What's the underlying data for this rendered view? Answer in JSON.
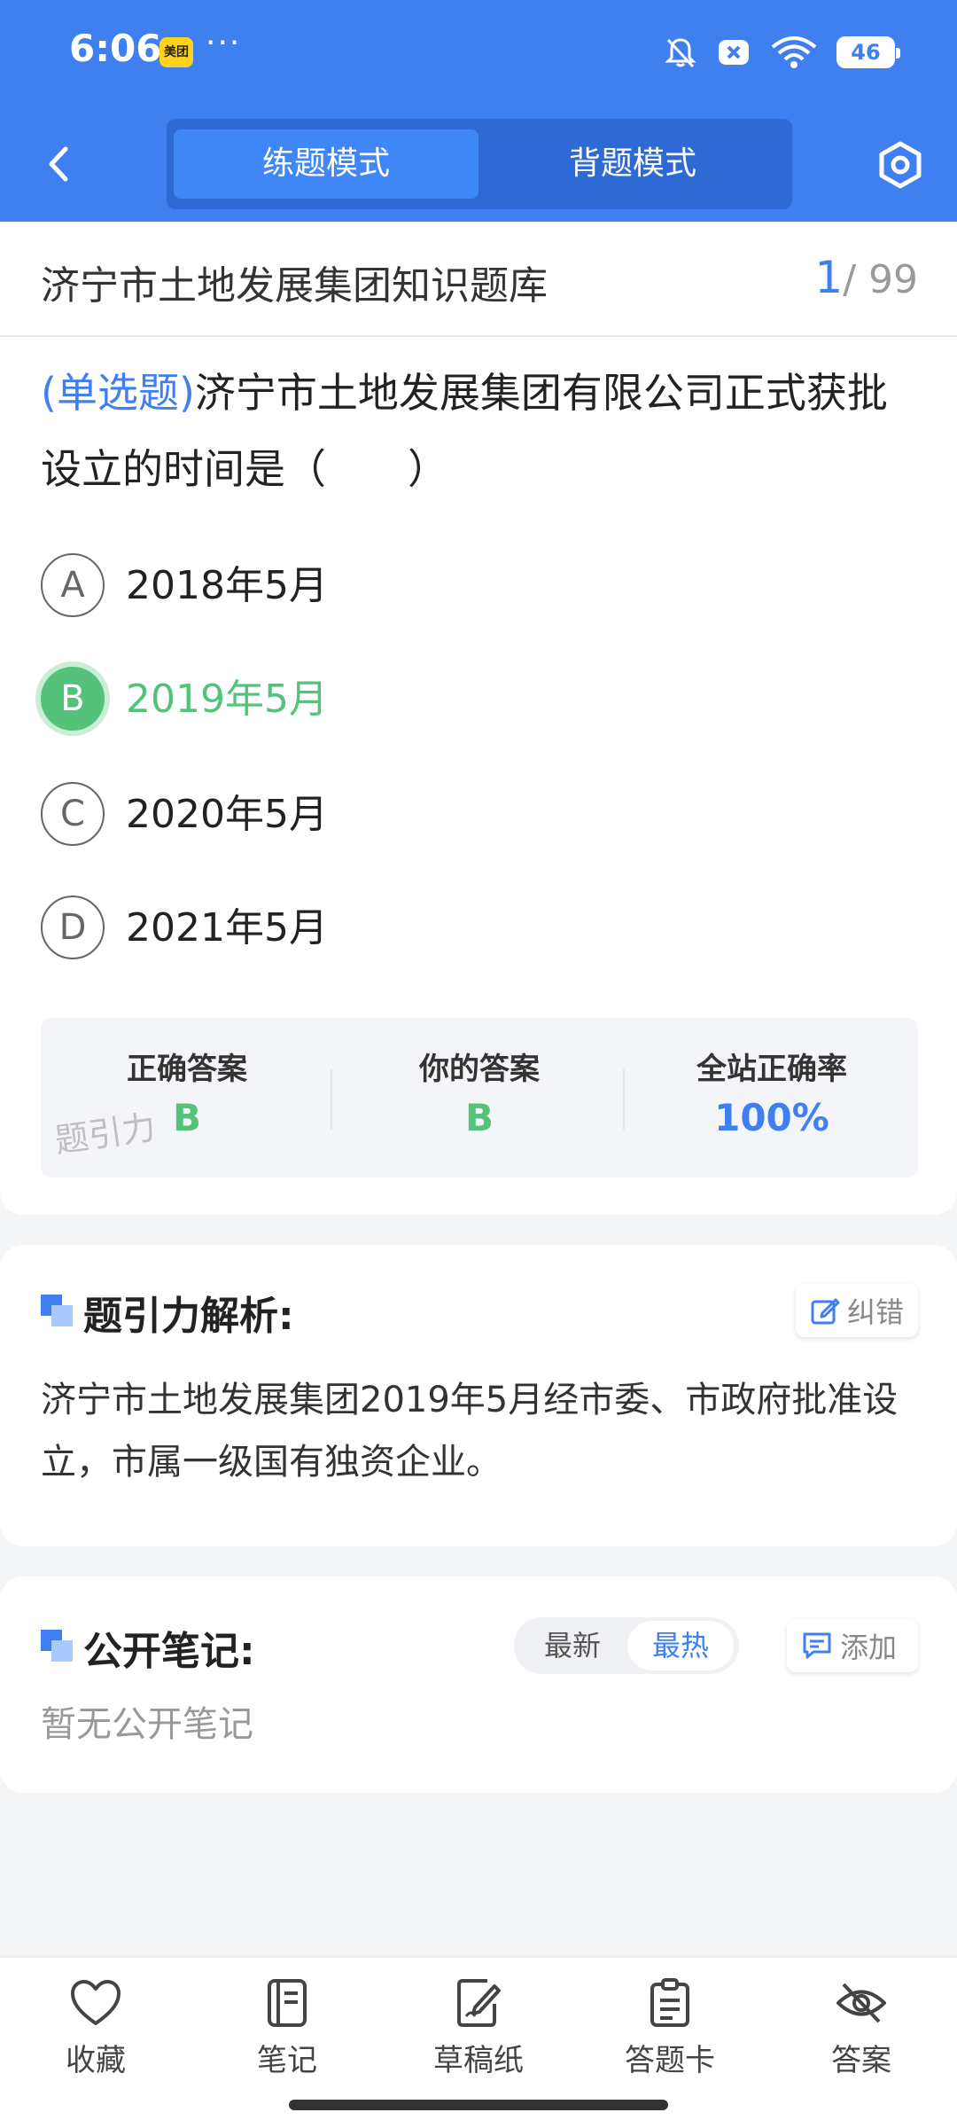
{
  "status_bar": {
    "time": "6:06",
    "app_badge": "美团",
    "more": "···",
    "battery": "46"
  },
  "header": {
    "tabs": [
      {
        "label": "练题模式",
        "active": true
      },
      {
        "label": "背题模式",
        "active": false
      }
    ],
    "accent_color": "#3f7ff0"
  },
  "bank": {
    "title": "济宁市土地发展集团知识题库",
    "current": "1",
    "total": "/ 99"
  },
  "question": {
    "type": "(单选题)",
    "text": "济宁市土地发展集团有限公司正式获批设立的时间是（　　）",
    "options": [
      {
        "letter": "A",
        "text": "2018年5月",
        "correct": false
      },
      {
        "letter": "B",
        "text": "2019年5月",
        "correct": true
      },
      {
        "letter": "C",
        "text": "2020年5月",
        "correct": false
      },
      {
        "letter": "D",
        "text": "2021年5月",
        "correct": false
      }
    ],
    "correct_color": "#54c27b"
  },
  "answer_box": {
    "correct_label": "正确答案",
    "correct_value": "B",
    "yours_label": "你的答案",
    "yours_value": "B",
    "rate_label": "全站正确率",
    "rate_value": "100%",
    "watermark": "题引力"
  },
  "analysis": {
    "title": "题引力解析:",
    "report_label": "纠错",
    "text": "济宁市土地发展集团2019年5月经市委、市政府批准设立，市属一级国有独资企业。"
  },
  "notes": {
    "title": "公开笔记:",
    "sort_latest": "最新",
    "sort_hot": "最热",
    "add_label": "添加",
    "empty_text": "暂无公开笔记"
  },
  "bottom_nav": [
    {
      "label": "收藏",
      "icon": "heart-icon"
    },
    {
      "label": "笔记",
      "icon": "notebook-icon"
    },
    {
      "label": "草稿纸",
      "icon": "draft-paper-icon"
    },
    {
      "label": "答题卡",
      "icon": "answer-sheet-icon"
    },
    {
      "label": "答案",
      "icon": "eye-off-icon"
    }
  ]
}
